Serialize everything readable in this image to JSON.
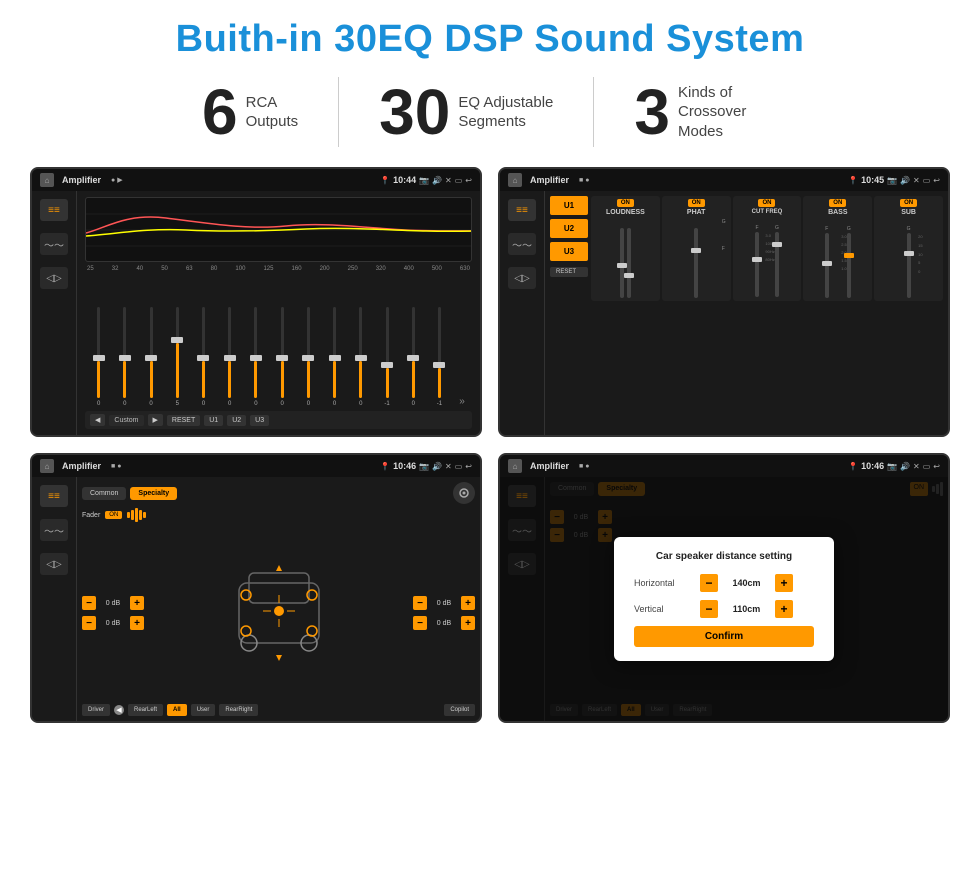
{
  "page": {
    "title": "Buith-in 30EQ DSP Sound System",
    "stats": [
      {
        "number": "6",
        "label": "RCA\nOutputs"
      },
      {
        "number": "30",
        "label": "EQ Adjustable\nSegments"
      },
      {
        "number": "3",
        "label": "Kinds of\nCrossover Modes"
      }
    ]
  },
  "screens": {
    "screen1": {
      "title": "Amplifier",
      "time": "10:44",
      "eq_freqs": [
        "25",
        "32",
        "40",
        "50",
        "63",
        "80",
        "100",
        "125",
        "160",
        "200",
        "250",
        "320",
        "400",
        "500",
        "630"
      ],
      "eq_values": [
        "0",
        "0",
        "0",
        "5",
        "0",
        "0",
        "0",
        "0",
        "0",
        "0",
        "0",
        "-1",
        "0",
        "-1"
      ],
      "preset_label": "Custom",
      "buttons": [
        "RESET",
        "U1",
        "U2",
        "U3"
      ]
    },
    "screen2": {
      "title": "Amplifier",
      "time": "10:45",
      "presets": [
        "U1",
        "U2",
        "U3"
      ],
      "modules": [
        "LOUDNESS",
        "PHAT",
        "CUT FREQ",
        "BASS",
        "SUB"
      ],
      "reset_label": "RESET"
    },
    "screen3": {
      "title": "Amplifier",
      "time": "10:46",
      "tabs": [
        "Common",
        "Specialty"
      ],
      "fader_label": "Fader",
      "fader_on": "ON",
      "db_values": [
        "0 dB",
        "0 dB",
        "0 dB",
        "0 dB"
      ],
      "bottom_btns": [
        "Driver",
        "RearLeft",
        "All",
        "User",
        "RearRight",
        "Copilot"
      ]
    },
    "screen4": {
      "title": "Amplifier",
      "time": "10:46",
      "tabs": [
        "Common",
        "Specialty"
      ],
      "dialog": {
        "title": "Car speaker distance setting",
        "horizontal_label": "Horizontal",
        "horizontal_value": "140cm",
        "vertical_label": "Vertical",
        "vertical_value": "110cm",
        "confirm_label": "Confirm",
        "minus_label": "−",
        "plus_label": "+"
      },
      "db_values": [
        "0 dB",
        "0 dB"
      ],
      "bottom_btns": [
        "Driver",
        "RearLeft",
        "All",
        "User",
        "RearRight",
        "Copilot"
      ]
    }
  }
}
